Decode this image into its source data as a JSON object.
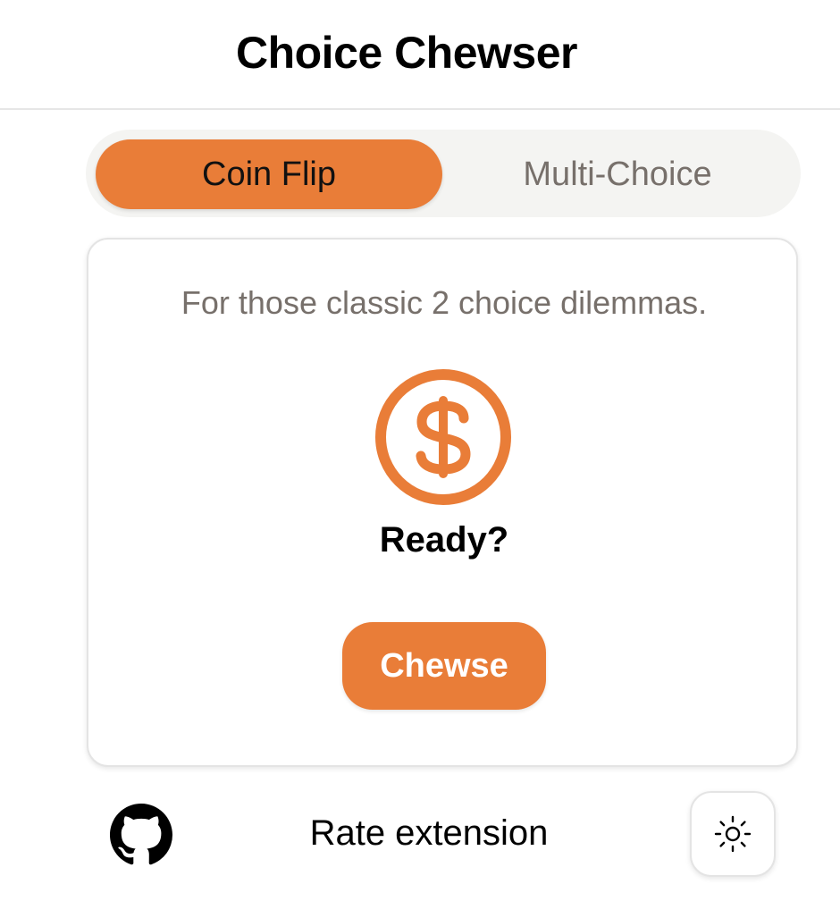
{
  "header": {
    "title": "Choice Chewser"
  },
  "tabs": [
    {
      "label": "Coin Flip",
      "active": true
    },
    {
      "label": "Multi-Choice",
      "active": false
    }
  ],
  "card": {
    "tagline": "For those classic 2 choice dilemmas.",
    "coin_icon": "dollar-coin-icon",
    "status": "Ready?",
    "button_label": "Chewse"
  },
  "footer": {
    "github_icon": "github-icon",
    "rate_label": "Rate extension",
    "theme_icon": "sun-icon"
  },
  "colors": {
    "accent": "#e97d38",
    "muted_text": "#77706b",
    "tab_track": "#f4f4f2"
  }
}
